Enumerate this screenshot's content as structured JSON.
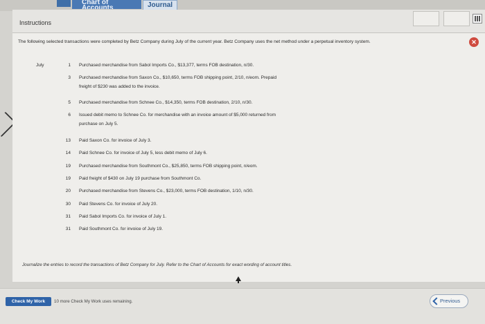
{
  "tabs": {
    "chart_of_accounts": "Chart of Accounts",
    "journal": "Journal"
  },
  "instructions": {
    "title": "Instructions",
    "intro": "The following selected transactions were completed by Betz Company during July of the current year. Betz Company uses the net method under a perpetual inventory system.",
    "month": "July",
    "transactions": [
      {
        "day": "1",
        "lines": [
          "Purchased merchandise from Sabol Imports Co., $13,377, terms FOB destination, n/30."
        ]
      },
      {
        "day": "3",
        "lines": [
          "Purchased merchandise from Saxon Co., $10,650, terms FOB shipping point, 2/10, n/eom. Prepaid",
          "freight of $230 was added to the invoice."
        ]
      },
      {
        "day": "5",
        "lines": [
          "Purchased merchandise from Schnee Co., $14,350, terms FOB destination, 2/10, n/30."
        ]
      },
      {
        "day": "6",
        "lines": [
          "Issued debit memo to Schnee Co. for merchandise with an invoice amount of $5,000 returned from",
          "purchase on July 5."
        ]
      },
      {
        "day": "13",
        "lines": [
          "Paid Saxon Co. for invoice of July 3."
        ]
      },
      {
        "day": "14",
        "lines": [
          "Paid Schnee Co. for invoice of July 5, less debit memo of July 6."
        ]
      },
      {
        "day": "19",
        "lines": [
          "Purchased merchandise from Southmont Co., $25,850, terms FOB shipping point, n/eom."
        ]
      },
      {
        "day": "19",
        "lines": [
          "Paid freight of $430 on July 19 purchase from Southmont Co."
        ]
      },
      {
        "day": "20",
        "lines": [
          "Purchased merchandise from Stevens Co., $23,000, terms FOB destination, 1/10, n/30."
        ]
      },
      {
        "day": "30",
        "lines": [
          "Paid Stevens Co. for invoice of July 20."
        ]
      },
      {
        "day": "31",
        "lines": [
          "Paid Sabol Imports Co. for invoice of July 1."
        ]
      },
      {
        "day": "31",
        "lines": [
          "Paid Southmont Co. for invoice of July 19."
        ]
      }
    ],
    "footer": "Journalize the entries to record the transactions of Betz Company for July. Refer to the Chart of Accounts for exact wording of account titles."
  },
  "bottom": {
    "check_label": "Check My Work",
    "remaining": "10 more Check My Work uses remaining.",
    "previous_label": "Previous"
  },
  "colors": {
    "accent": "#2f63a8",
    "close": "#cf4b3f"
  }
}
